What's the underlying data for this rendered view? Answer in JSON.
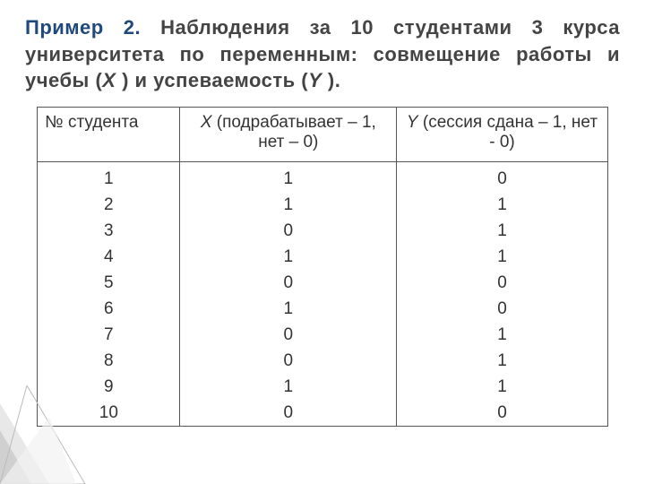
{
  "title": {
    "lead": "Пример 2.",
    "body_before_x": " Наблюдения за 10 студентами 3 курса университета по переменным: совмещение работы и учебы (",
    "x": "X",
    "body_mid": " ) и успеваемость (",
    "y": "Y",
    "body_end": " )."
  },
  "headers": {
    "num": "№ студента",
    "x_var": "X",
    "x_rest": " (подрабатывает – 1, нет – 0)",
    "y_var": "Y",
    "y_rest": " (сессия сдана – 1, нет - 0)"
  },
  "rows": {
    "num": [
      "1",
      "2",
      "3",
      "4",
      "5",
      "6",
      "7",
      "8",
      "9",
      "10"
    ],
    "x": [
      "1",
      "1",
      "0",
      "1",
      "0",
      "1",
      "0",
      "0",
      "1",
      "0"
    ],
    "y": [
      "0",
      "1",
      "1",
      "1",
      "0",
      "0",
      "1",
      "1",
      "1",
      "0"
    ]
  },
  "chart_data": {
    "type": "table",
    "title": "Наблюдения за 10 студентами 3 курса: совмещение работы и учебы (X) и успеваемость (Y)",
    "columns": [
      "№ студента",
      "X (подрабатывает – 1, нет – 0)",
      "Y (сессия сдана – 1, нет - 0)"
    ],
    "data": [
      {
        "num": 1,
        "X": 1,
        "Y": 0
      },
      {
        "num": 2,
        "X": 1,
        "Y": 1
      },
      {
        "num": 3,
        "X": 0,
        "Y": 1
      },
      {
        "num": 4,
        "X": 1,
        "Y": 1
      },
      {
        "num": 5,
        "X": 0,
        "Y": 0
      },
      {
        "num": 6,
        "X": 1,
        "Y": 0
      },
      {
        "num": 7,
        "X": 0,
        "Y": 1
      },
      {
        "num": 8,
        "X": 0,
        "Y": 1
      },
      {
        "num": 9,
        "X": 1,
        "Y": 1
      },
      {
        "num": 10,
        "X": 0,
        "Y": 0
      }
    ]
  }
}
